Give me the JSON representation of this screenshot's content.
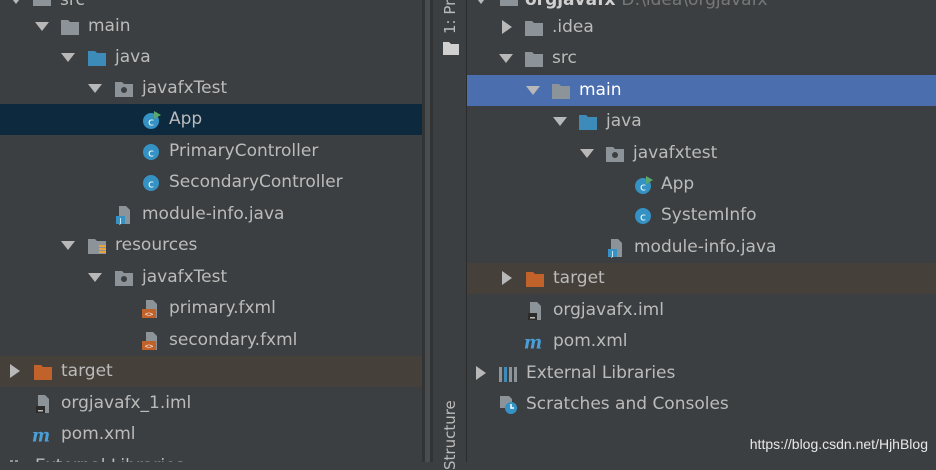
{
  "left_tree": {
    "partial_top": "src",
    "items": [
      {
        "label": "main"
      },
      {
        "label": "java"
      },
      {
        "label": "javafxTest"
      },
      {
        "label": "App"
      },
      {
        "label": "PrimaryController"
      },
      {
        "label": "SecondaryController"
      },
      {
        "label": "module-info.java"
      },
      {
        "label": "resources"
      },
      {
        "label": "javafxTest"
      },
      {
        "label": "primary.fxml"
      },
      {
        "label": "secondary.fxml"
      },
      {
        "label": "target"
      },
      {
        "label": "orgjavafx_1.iml"
      },
      {
        "label": "pom.xml"
      }
    ],
    "partial_bottom": "External Libraries"
  },
  "tool_strip": {
    "top_tab": "1: Pr",
    "bottom_tab": "Structure"
  },
  "right_tree": {
    "partial_top_project": "orgjavafx",
    "partial_top_path": "D:\\idea\\orgjavafx",
    "items": [
      {
        "label": ".idea"
      },
      {
        "label": "src"
      },
      {
        "label": "main"
      },
      {
        "label": "java"
      },
      {
        "label": "javafxtest"
      },
      {
        "label": "App"
      },
      {
        "label": "SystemInfo"
      },
      {
        "label": "module-info.java"
      },
      {
        "label": "target"
      },
      {
        "label": "orgjavafx.iml"
      },
      {
        "label": "pom.xml"
      },
      {
        "label": "External Libraries"
      },
      {
        "label": "Scratches and Consoles"
      }
    ]
  },
  "watermark": "https://blog.csdn.net/HjhBlog",
  "colors": {
    "background": "#3c3f41",
    "selection_inactive": "#0d293e",
    "selection_active": "#4b6eaf",
    "excluded_row": "#45403a",
    "folder": "#8c9499",
    "source_folder": "#3d8bb8",
    "excluded_folder": "#c2622b",
    "class_icon": "#3592c4",
    "fxml_icon": "#c2622b",
    "maven_icon": "#4a9fd8"
  }
}
